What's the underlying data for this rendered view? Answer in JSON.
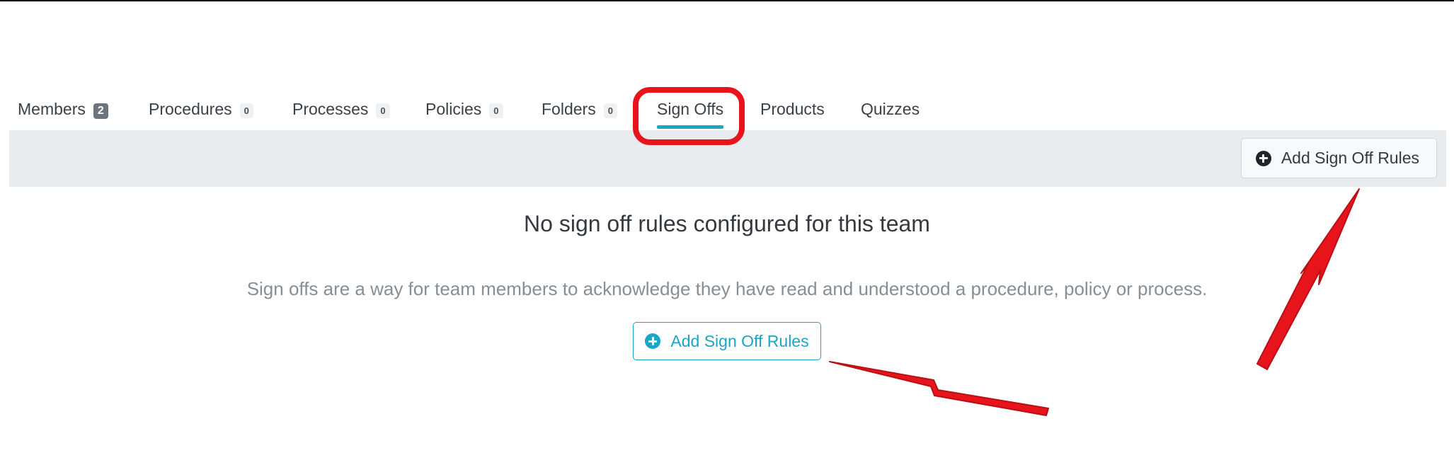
{
  "tabs": [
    {
      "label": "Members",
      "badge": "2"
    },
    {
      "label": "Procedures",
      "badge": "0"
    },
    {
      "label": "Processes",
      "badge": "0"
    },
    {
      "label": "Policies",
      "badge": "0"
    },
    {
      "label": "Folders",
      "badge": "0"
    },
    {
      "label": "Sign Offs",
      "active": true
    },
    {
      "label": "Products"
    },
    {
      "label": "Quizzes"
    }
  ],
  "toolbar": {
    "add_button_label": "Add Sign Off Rules",
    "add_button_icon": "plus-circle-icon"
  },
  "empty_state": {
    "title": "No sign off rules configured for this team",
    "description": "Sign offs are a way for team members to acknowledge they have read and understood a procedure, policy or process.",
    "add_button_label": "Add Sign Off Rules",
    "add_button_icon": "plus-circle-icon"
  },
  "colors": {
    "accent": "#1aa6c4",
    "toolbar_bg": "#e9ecef",
    "annotation_red": "#e8141c"
  }
}
